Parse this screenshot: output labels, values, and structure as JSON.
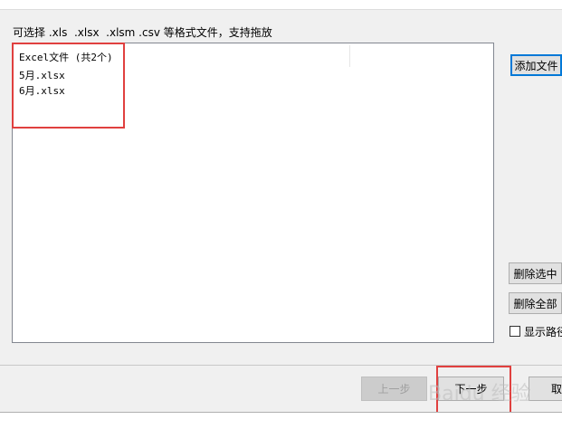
{
  "instruction": "可选择 .xls  .xlsx  .xlsm .csv 等格式文件，支持拖放",
  "list": {
    "header": "Excel文件 (共2个)",
    "files": [
      "5月.xlsx",
      "6月.xlsx"
    ]
  },
  "buttons": {
    "add_files": "添加文件",
    "delete_selected": "删除选中",
    "delete_all": "删除全部",
    "prev": "上一步",
    "next": "下一步",
    "cancel": "取消"
  },
  "checkbox": {
    "label": "显示路径",
    "checked": false
  },
  "watermark": "Baidu 经验",
  "colors": {
    "highlight": "#e0403f",
    "accent": "#0078d7"
  }
}
